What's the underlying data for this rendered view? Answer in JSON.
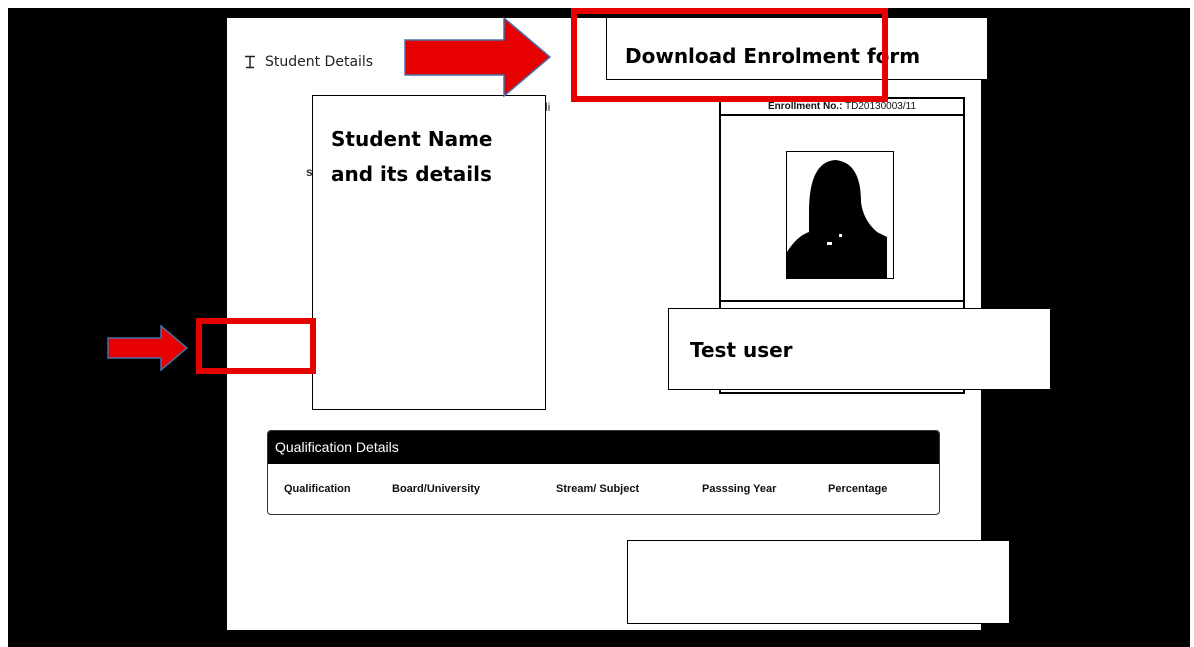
{
  "panel": {
    "title": "Student Details",
    "stray_text_1": "li",
    "stray_text_2": "s"
  },
  "enrollment": {
    "label": "Enrollment No.:",
    "value": "TD20130003/11"
  },
  "callouts": {
    "student_name": "Student Name and its details",
    "download": "Download Enrolment form",
    "test_user": "Test user"
  },
  "qualification": {
    "title": "Qualification Details",
    "columns": [
      "Qualification",
      "Board/University",
      "Stream/ Subject",
      "Passsing Year",
      "Percentage"
    ]
  },
  "colors": {
    "annotation_red": "#e60000",
    "arrow_outline": "#4a6fa5",
    "header_black": "#000000"
  }
}
